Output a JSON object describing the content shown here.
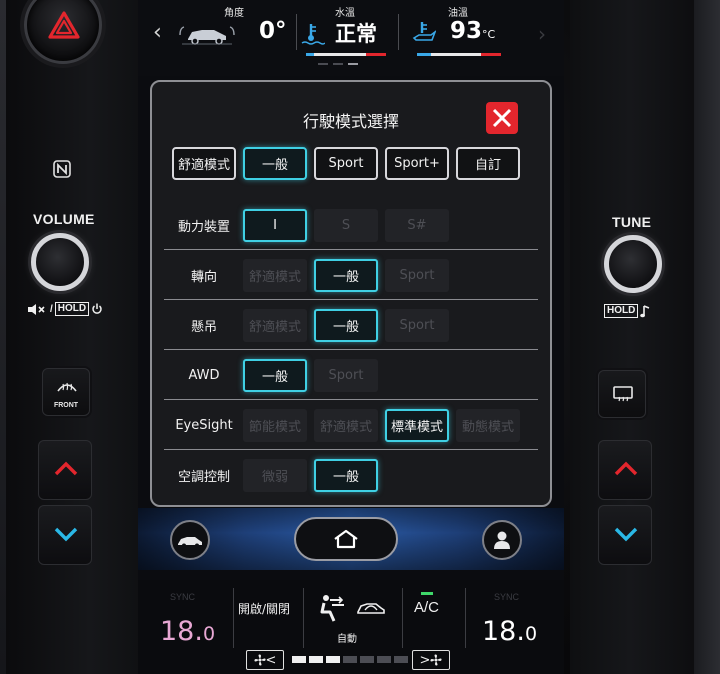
{
  "status": {
    "angle_title": "角度",
    "angle_value": "0°",
    "water_title": "水溫",
    "water_value": "正常",
    "oil_title": "油溫",
    "oil_value": "93",
    "oil_unit": "°C"
  },
  "dialog": {
    "title": "行駛模式選擇",
    "modes": [
      {
        "label": "舒適模式",
        "selected": false
      },
      {
        "label": "一般",
        "selected": true
      },
      {
        "label": "Sport",
        "selected": false
      },
      {
        "label": "Sport+",
        "selected": false
      },
      {
        "label": "自訂",
        "selected": false
      }
    ],
    "settings": [
      {
        "label": "動力裝置",
        "options": [
          "I",
          "S",
          "S#"
        ],
        "selected": "I"
      },
      {
        "label": "轉向",
        "options": [
          "舒適模式",
          "一般",
          "Sport"
        ],
        "selected": "一般"
      },
      {
        "label": "懸吊",
        "options": [
          "舒適模式",
          "一般",
          "Sport"
        ],
        "selected": "一般"
      },
      {
        "label": "AWD",
        "options": [
          "一般",
          "Sport"
        ],
        "selected": "一般"
      },
      {
        "label": "EyeSight",
        "options": [
          "節能模式",
          "舒適模式",
          "標準模式",
          "動態模式"
        ],
        "selected": "標準模式"
      },
      {
        "label": "空調控制",
        "options": [
          "微弱",
          "一般"
        ],
        "selected": "一般"
      }
    ]
  },
  "bezel": {
    "volume_label": "VOLUME",
    "volume_sub": "HOLD",
    "tune_label": "TUNE",
    "tune_sub": "HOLD",
    "front_label": "FRONT"
  },
  "climate": {
    "sync_left": "SYNC",
    "sync_right": "SYNC",
    "temp_left_int": "18.",
    "temp_left_dec": "0",
    "temp_right_int": "18.",
    "temp_right_dec": "0",
    "on_off": "開啟/關閉",
    "auto": "自動",
    "ac": "A/C",
    "fan_level": 0.4
  },
  "colors": {
    "accent": "#3fd0e4",
    "close": "#e3262d",
    "temp_left": "#e8a8d4",
    "temp_right": "#ffffff",
    "arrow_up": "#e3262d",
    "arrow_down": "#2ab8e6"
  },
  "icons": {
    "hazard": "hazard-icon",
    "nfc": "nfc-icon",
    "mute": "mute-icon",
    "power": "power-icon",
    "note": "music-note-icon",
    "defrost_front": "front-defrost-icon",
    "defrost_rear": "rear-defrost-icon",
    "vehicle": "vehicle-icon",
    "home": "home-icon",
    "profile": "profile-icon",
    "seat": "seat-airflow-icon",
    "car_recirc": "car-recirculation-icon",
    "fan": "fan-icon"
  }
}
